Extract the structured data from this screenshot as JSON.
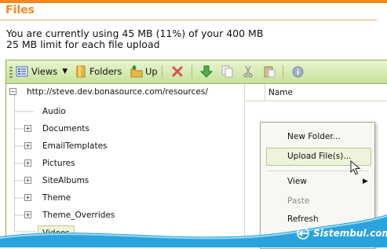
{
  "page": {
    "title": "Files",
    "usage_line1": "You are currently using 45 MB (11%) of your 400 MB",
    "usage_line2": "25 MB limit for each file upload"
  },
  "toolbar": {
    "views_label": "Views",
    "folders_label": "Folders",
    "up_label": "Up"
  },
  "tree": {
    "root": "http://steve.dev.bonasource.com/resources/",
    "items": [
      {
        "label": "Audio",
        "expandable": false
      },
      {
        "label": "Documents",
        "expandable": true
      },
      {
        "label": "EmailTemplates",
        "expandable": true
      },
      {
        "label": "Pictures",
        "expandable": true
      },
      {
        "label": "SiteAlbums",
        "expandable": true
      },
      {
        "label": "Theme",
        "expandable": true
      },
      {
        "label": "Theme_Overrides",
        "expandable": true
      },
      {
        "label": "Videos",
        "expandable": false,
        "selected": true
      }
    ]
  },
  "grid": {
    "column_name": "Name"
  },
  "context_menu": {
    "items": [
      {
        "label": "New Folder...",
        "enabled": true
      },
      {
        "label": "Upload File(s)...",
        "enabled": true,
        "highlighted": true
      },
      {
        "label": "View",
        "enabled": true,
        "submenu": true
      },
      {
        "label": "Paste",
        "enabled": false
      },
      {
        "label": "Refresh",
        "enabled": true
      }
    ]
  },
  "watermark": {
    "text": "Sistembul.com"
  },
  "colors": {
    "accent_orange": "#f08a24",
    "toolbar_green": "#c7e29a",
    "watermark_blue": "#2aa3dd"
  }
}
